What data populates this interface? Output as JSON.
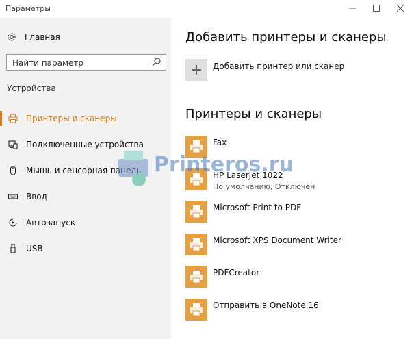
{
  "window": {
    "title": "Параметры"
  },
  "sidebar": {
    "home_label": "Главная",
    "search_placeholder": "Найти параметр",
    "section_title": "Устройства",
    "items": [
      {
        "label": "Принтеры и сканеры",
        "icon": "printer-icon",
        "active": true
      },
      {
        "label": "Подключенные устройства",
        "icon": "devices-icon",
        "active": false
      },
      {
        "label": "Мышь и сенсорная панель",
        "icon": "mouse-icon",
        "active": false
      },
      {
        "label": "Ввод",
        "icon": "keyboard-icon",
        "active": false
      },
      {
        "label": "Автозапуск",
        "icon": "autoplay-icon",
        "active": false
      },
      {
        "label": "USB",
        "icon": "usb-icon",
        "active": false
      }
    ]
  },
  "main": {
    "add_heading": "Добавить принтеры и сканеры",
    "add_label": "Добавить принтер или сканер",
    "list_heading": "Принтеры и сканеры",
    "printers": [
      {
        "name": "Fax",
        "status": ""
      },
      {
        "name": "HP LaserJet 1022",
        "status": "По умолчанию, Отключен"
      },
      {
        "name": "Microsoft Print to PDF",
        "status": ""
      },
      {
        "name": "Microsoft XPS Document Writer",
        "status": ""
      },
      {
        "name": "PDFCreator",
        "status": ""
      },
      {
        "name": "Отправить в OneNote 16",
        "status": ""
      }
    ]
  },
  "watermark": {
    "text": "Printeros.ru"
  },
  "colors": {
    "accent": "#d87b1a",
    "printer_tile": "#e5a046"
  }
}
